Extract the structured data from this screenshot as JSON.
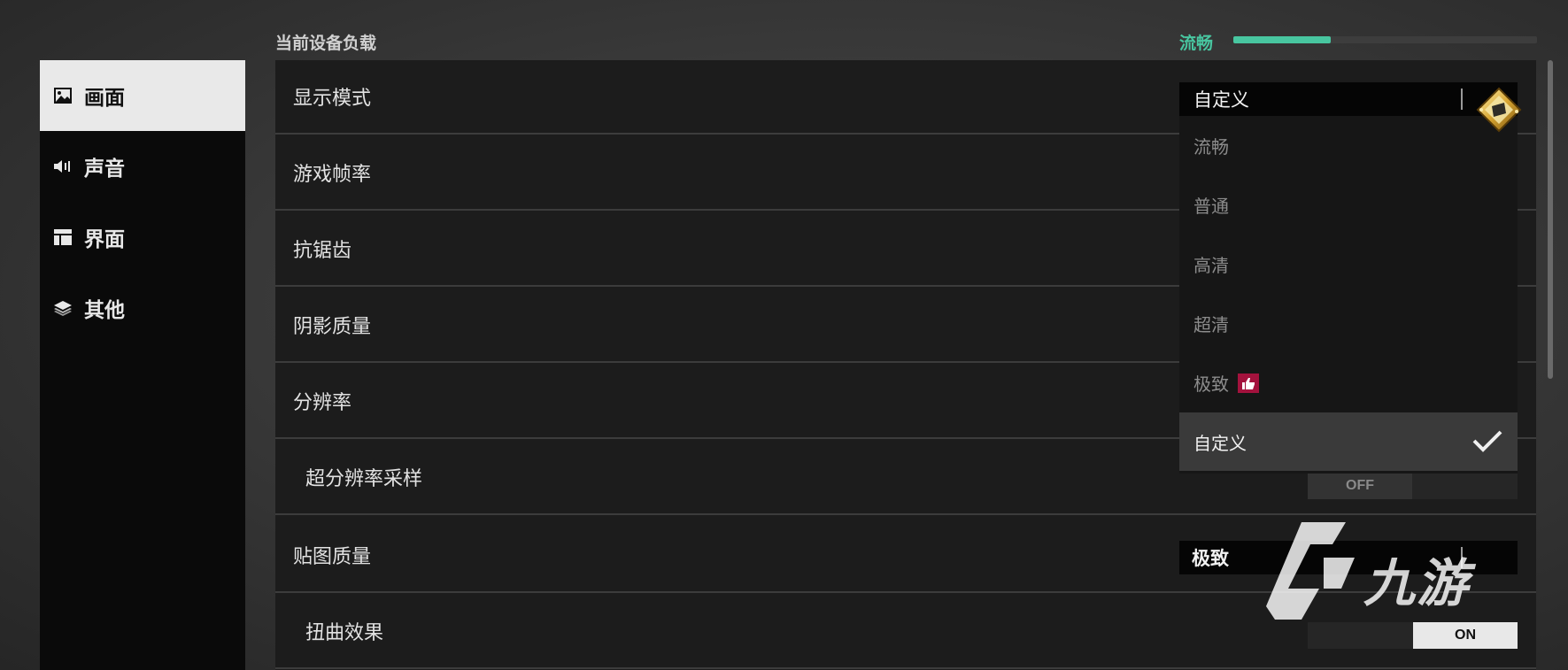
{
  "header": {
    "load_label": "当前设备负载",
    "load_status": "流畅",
    "load_level_fraction": 0.32,
    "status_color": "#48c6a0"
  },
  "sidebar": {
    "items": [
      {
        "label": "画面",
        "icon": "image-icon",
        "active": true
      },
      {
        "label": "声音",
        "icon": "speaker-icon",
        "active": false
      },
      {
        "label": "界面",
        "icon": "layout-icon",
        "active": false
      },
      {
        "label": "其他",
        "icon": "layers-icon",
        "active": false
      }
    ]
  },
  "settings": {
    "rows": [
      {
        "label": "显示模式"
      },
      {
        "label": "游戏帧率"
      },
      {
        "label": "抗锯齿"
      },
      {
        "label": "阴影质量"
      },
      {
        "label": "分辨率"
      },
      {
        "label": "超分辨率采样",
        "toggle": "OFF"
      },
      {
        "label": "贴图质量",
        "value": "极致"
      },
      {
        "label": "扭曲效果",
        "toggle": "ON"
      }
    ]
  },
  "display_mode_dropdown": {
    "current": "自定义",
    "options": [
      "流畅",
      "普通",
      "高清",
      "超清",
      "极致",
      "自定义"
    ],
    "selected": "自定义",
    "recommended": "极致",
    "badge_color": "#a3123d"
  },
  "watermark": {
    "text": "九游"
  }
}
